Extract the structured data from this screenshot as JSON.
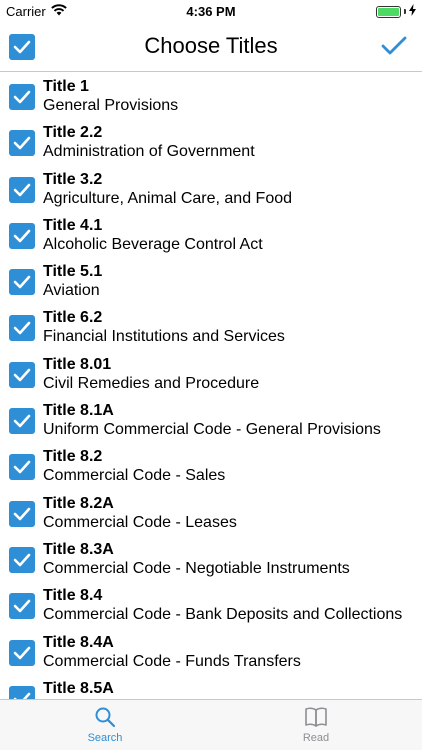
{
  "status_bar": {
    "carrier": "Carrier",
    "time": "4:36 PM"
  },
  "nav": {
    "title": "Choose Titles"
  },
  "titles": [
    {
      "title": "Title 1",
      "subtitle": "General Provisions"
    },
    {
      "title": "Title 2.2",
      "subtitle": "Administration of Government"
    },
    {
      "title": "Title 3.2",
      "subtitle": "Agriculture, Animal Care, and Food"
    },
    {
      "title": "Title 4.1",
      "subtitle": "Alcoholic Beverage Control Act"
    },
    {
      "title": "Title 5.1",
      "subtitle": "Aviation"
    },
    {
      "title": "Title 6.2",
      "subtitle": "Financial Institutions and Services"
    },
    {
      "title": "Title 8.01",
      "subtitle": "Civil Remedies and Procedure"
    },
    {
      "title": "Title 8.1A",
      "subtitle": "Uniform Commercial Code - General Provisions"
    },
    {
      "title": "Title 8.2",
      "subtitle": "Commercial Code - Sales"
    },
    {
      "title": "Title 8.2A",
      "subtitle": "Commercial Code - Leases"
    },
    {
      "title": "Title 8.3A",
      "subtitle": "Commercial Code - Negotiable Instruments"
    },
    {
      "title": "Title 8.4",
      "subtitle": "Commercial Code - Bank Deposits and Collections"
    },
    {
      "title": "Title 8.4A",
      "subtitle": "Commercial Code - Funds Transfers"
    },
    {
      "title": "Title 8.5A",
      "subtitle": ""
    }
  ],
  "tabs": {
    "search_label": "Search",
    "read_label": "Read"
  },
  "colors": {
    "accent": "#2e8fd6",
    "inactive": "#8e8e93"
  }
}
